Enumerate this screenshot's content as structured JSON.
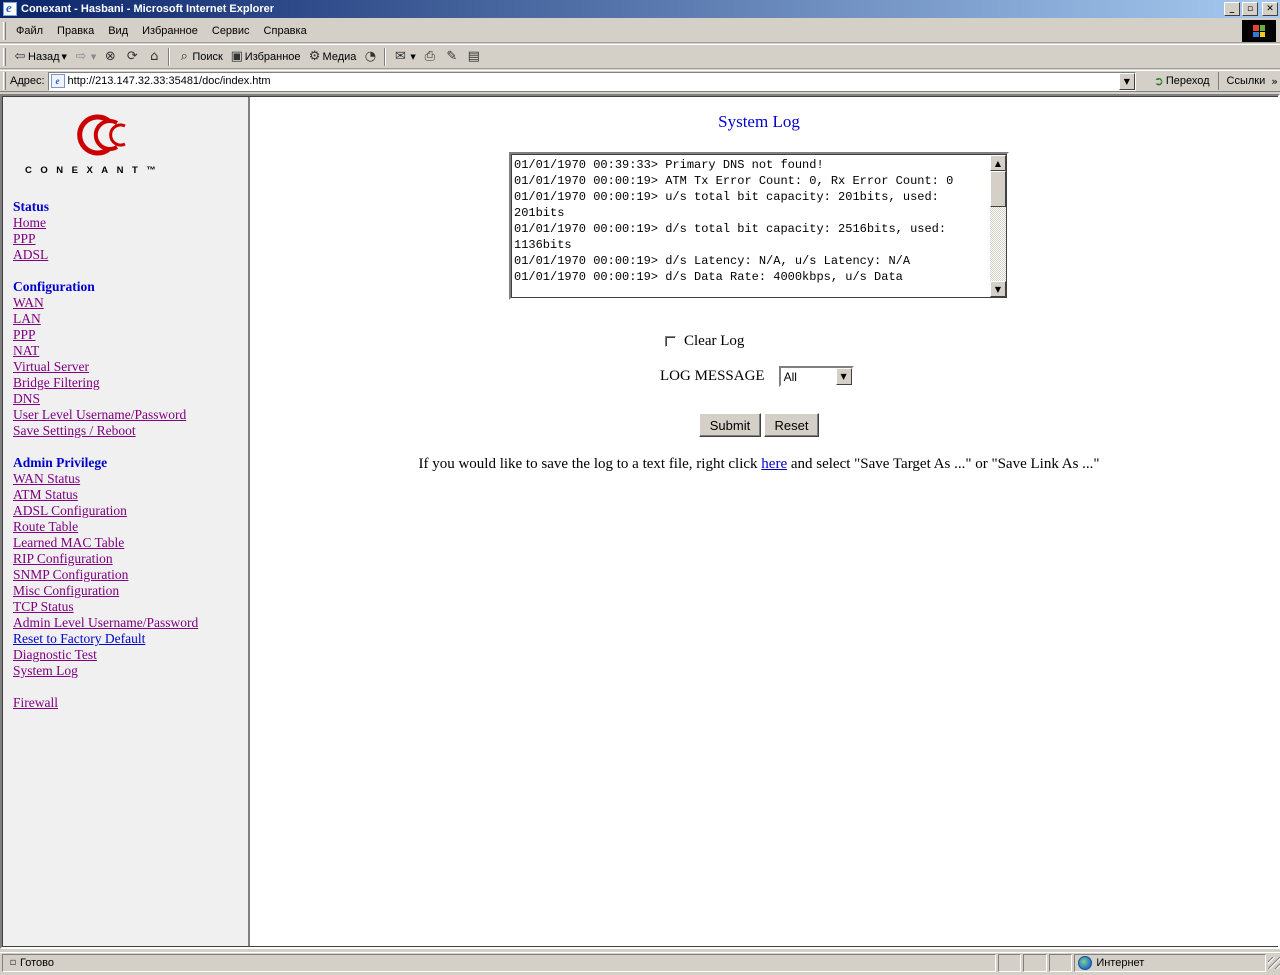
{
  "window": {
    "title": "Conexant - Hasbani - Microsoft Internet Explorer",
    "controls": [
      "_",
      "▫",
      "✕"
    ]
  },
  "menu": [
    "Файл",
    "Правка",
    "Вид",
    "Избранное",
    "Сервис",
    "Справка"
  ],
  "toolbar": {
    "back": "Назад",
    "search": "Поиск",
    "favorites": "Избранное",
    "media": "Медиа"
  },
  "address": {
    "label": "Адрес:",
    "url": "http://213.147.32.33:35481/doc/index.htm",
    "go": "Переход",
    "links": "Ссылки"
  },
  "sidebar": {
    "logo_text": "CONEXANT™",
    "logo_color": "#cc0000",
    "status": {
      "title": "Status",
      "items": [
        "Home",
        "PPP",
        "ADSL"
      ]
    },
    "configuration": {
      "title": "Configuration",
      "items": [
        "WAN",
        "LAN",
        "PPP",
        "NAT",
        "Virtual Server",
        "Bridge Filtering",
        "DNS",
        "User Level Username/Password",
        "Save Settings / Reboot"
      ]
    },
    "admin": {
      "title": "Admin Privilege",
      "items": [
        "WAN Status",
        "ATM Status",
        "ADSL Configuration",
        "Route Table",
        "Learned MAC Table",
        "RIP Configuration",
        "SNMP Configuration",
        "Misc Configuration",
        "TCP Status",
        "Admin Level Username/Password",
        "Reset to Factory Default",
        "Diagnostic Test",
        "System Log"
      ]
    },
    "firewall": "Firewall"
  },
  "main": {
    "title": "System Log",
    "log": "01/01/1970 00:39:33> Primary DNS not found!\n01/01/1970 00:00:19> ATM Tx Error Count: 0, Rx Error Count: 0\n01/01/1970 00:00:19> u/s total bit capacity: 201bits, used: 201bits\n01/01/1970 00:00:19> d/s total bit capacity: 2516bits, used: 1136bits\n01/01/1970 00:00:19> d/s Latency: N/A, u/s Latency: N/A\n01/01/1970 00:00:19> d/s Data Rate: 4000kbps, u/s Data",
    "clear_log": "Clear Log",
    "log_message_label": "LOG MESSAGE",
    "log_message_value": "All",
    "submit": "Submit",
    "reset": "Reset",
    "save_note_before": "If you would like to save the log to a text file, right click",
    "save_note_link": "here",
    "save_note_after": "and select \"Save Target As ...\" or \"Save Link As ...\""
  },
  "status_bar": {
    "text": "Готово",
    "zone": "Интернет"
  }
}
